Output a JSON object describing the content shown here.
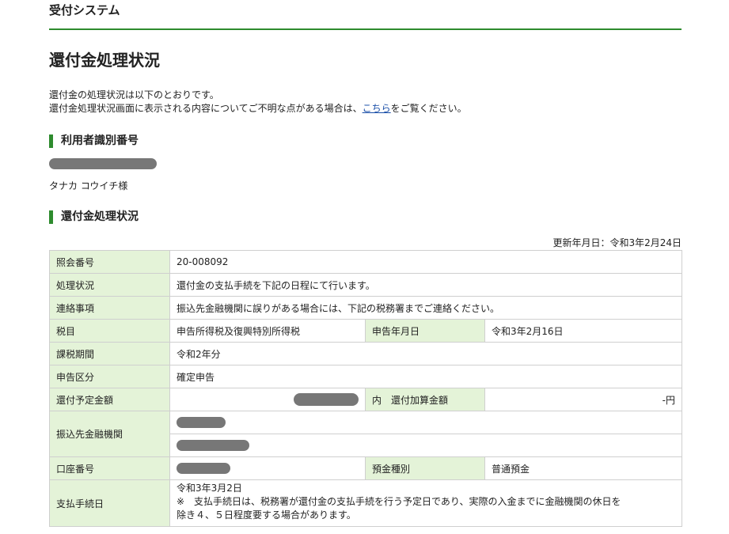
{
  "header": {
    "system_title": "受付システム"
  },
  "page": {
    "title": "還付金処理状況",
    "intro_line1": "還付金の処理状況は以下のとおりです。",
    "intro_line2_pre": "還付金処理状況画面に表示される内容についてご不明な点がある場合は、",
    "intro_link": "こちら",
    "intro_line2_post": "をご覧ください。"
  },
  "user_section": {
    "heading": "利用者識別番号",
    "user_name": "タナカ コウイチ様"
  },
  "status_section": {
    "heading": "還付金処理状況",
    "updated": "更新年月日：令和3年2月24日"
  },
  "table": {
    "inquiry_no_label": "照会番号",
    "inquiry_no": "20-008092",
    "status_label": "処理状況",
    "status": "還付金の支払手続を下記の日程にて行います。",
    "contact_label": "連絡事項",
    "contact": "振込先金融機関に誤りがある場合には、下記の税務署までご連絡ください。",
    "tax_item_label": "税目",
    "tax_item": "申告所得税及復興特別所得税",
    "filing_date_label": "申告年月日",
    "filing_date": "令和3年2月16日",
    "tax_period_label": "課税期間",
    "tax_period": "令和2年分",
    "filing_type_label": "申告区分",
    "filing_type": "確定申告",
    "refund_amount_label": "還付予定金額",
    "refund_add_label": "内　還付加算金額",
    "refund_add_value": "-円",
    "bank_label": "振込先金融機関",
    "account_no_label": "口座番号",
    "deposit_type_label": "預金種別",
    "deposit_type": "普通預金",
    "payment_date_label": "支払手続日",
    "payment_date": "令和3年3月2日",
    "payment_note_line1": "※　支払手続日は、税務署が還付金の支払手続を行う予定日であり、実際の入金までに金融機関の休日を",
    "payment_note_line2": "除き４、５日程度要する場合があります。"
  }
}
